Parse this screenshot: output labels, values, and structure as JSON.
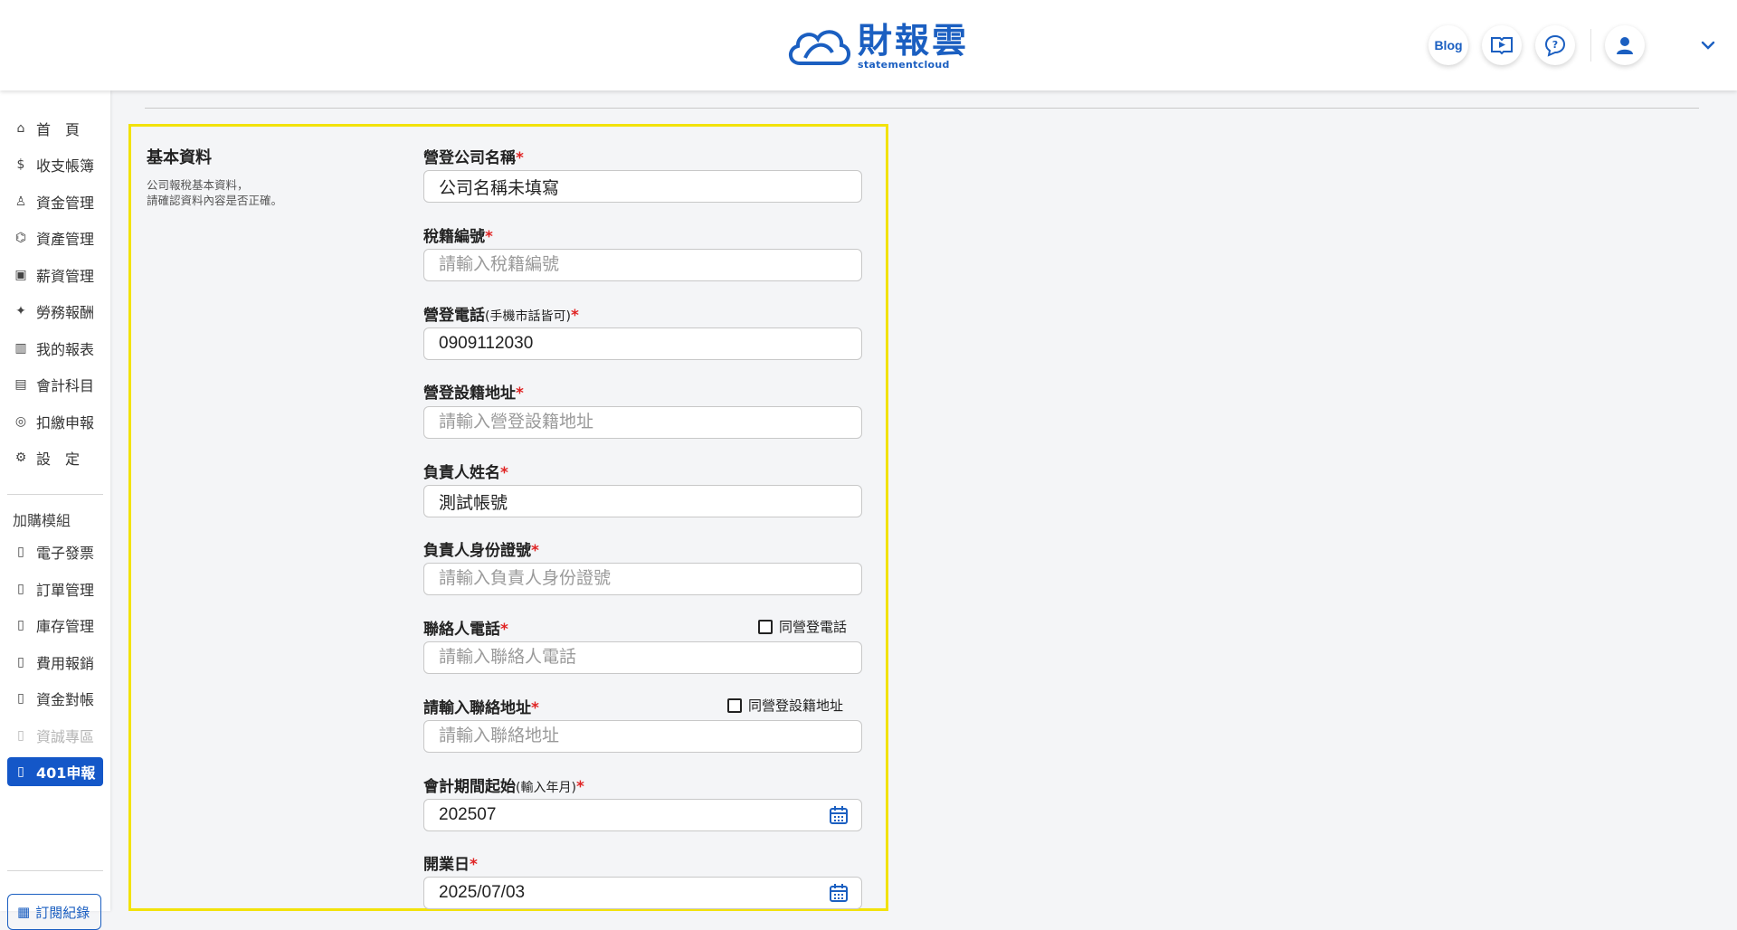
{
  "header": {
    "logo_zh": "財報雲",
    "logo_en": "statementcloud",
    "blog_label": "Blog"
  },
  "sidebar": {
    "main_items": [
      {
        "label": "首　頁",
        "icon": "home-icon"
      },
      {
        "label": "收支帳簿",
        "icon": "dollar-cycle-icon"
      },
      {
        "label": "資金管理",
        "icon": "funds-icon"
      },
      {
        "label": "資產管理",
        "icon": "assets-icon"
      },
      {
        "label": "薪資管理",
        "icon": "salary-icon"
      },
      {
        "label": "勞務報酬",
        "icon": "labor-icon"
      },
      {
        "label": "我的報表",
        "icon": "report-chart-icon"
      },
      {
        "label": "會計科目",
        "icon": "ledger-icon"
      },
      {
        "label": "扣繳申報",
        "icon": "withholding-icon"
      },
      {
        "label": "設　定",
        "icon": "settings-sliders-icon"
      }
    ],
    "addon_title": "加購模組",
    "addon_items": [
      {
        "label": "電子發票",
        "state": "normal"
      },
      {
        "label": "訂單管理",
        "state": "normal"
      },
      {
        "label": "庫存管理",
        "state": "normal"
      },
      {
        "label": "費用報銷",
        "state": "normal"
      },
      {
        "label": "資金對帳",
        "state": "normal"
      },
      {
        "label": "資誠專區",
        "state": "disabled"
      },
      {
        "label": "401申報",
        "state": "active"
      }
    ],
    "subscription_label": "訂閱紀錄"
  },
  "section": {
    "title": "基本資料",
    "desc_line1": "公司報稅基本資料，",
    "desc_line2": "請確認資料內容是否正確。"
  },
  "form": {
    "company_name": {
      "label": "營登公司名稱",
      "value": "公司名稱未填寫",
      "placeholder": ""
    },
    "tax_id": {
      "label": "稅籍編號",
      "value": "",
      "placeholder": "請輸入稅籍編號"
    },
    "reg_phone": {
      "label": "營登電話",
      "label_note": "(手機市話皆可)",
      "value": "0909112030",
      "placeholder": ""
    },
    "reg_address": {
      "label": "營登設籍地址",
      "value": "",
      "placeholder": "請輸入營登設籍地址"
    },
    "owner_name": {
      "label": "負責人姓名",
      "value": "測試帳號",
      "placeholder": ""
    },
    "owner_id": {
      "label": "負責人身份證號",
      "value": "",
      "placeholder": "請輸入負責人身份證號"
    },
    "contact_phone": {
      "label": "聯絡人電話",
      "value": "",
      "placeholder": "請輸入聯絡人電話",
      "checkbox_label": "同營登電話"
    },
    "contact_address": {
      "label": "請輸入聯絡地址",
      "value": "",
      "placeholder": "請輸入聯絡地址",
      "checkbox_label": "同營登設籍地址"
    },
    "period_start": {
      "label": "會計期間起始",
      "label_note": "(輸入年月)",
      "value": "202507",
      "placeholder": ""
    },
    "open_date": {
      "label": "開業日",
      "value": "2025/07/03",
      "placeholder": ""
    },
    "required_mark": "*"
  },
  "colors": {
    "brand": "#1b5fc1",
    "active_nav": "#1457c8",
    "highlight_border": "#f2e20a",
    "required": "#e02424"
  }
}
